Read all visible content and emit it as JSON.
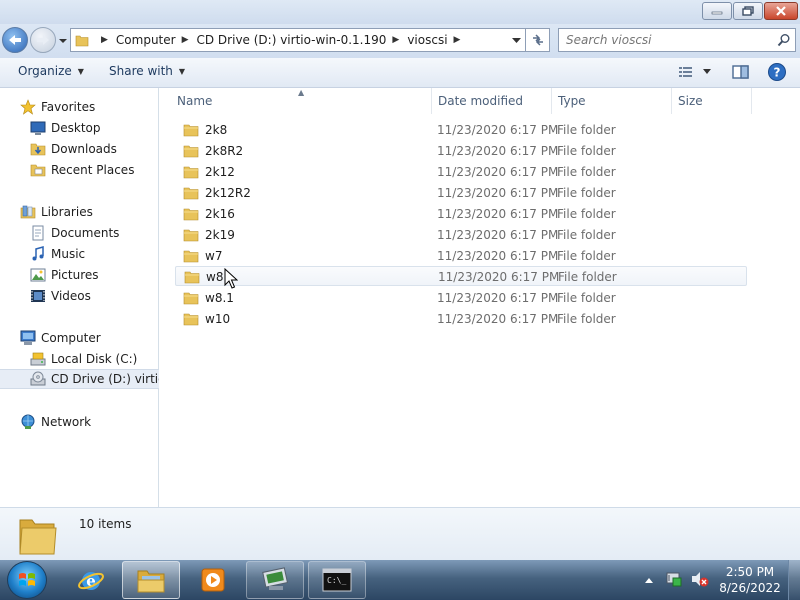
{
  "window": {
    "minimize_icon": "minimize-icon",
    "maximize_icon": "restore-icon",
    "close_icon": "close-icon"
  },
  "address": {
    "crumbs": [
      "Computer",
      "CD Drive (D:) virtio-win-0.1.190",
      "vioscsi"
    ],
    "search_placeholder": "Search vioscsi"
  },
  "toolbar": {
    "organize_label": "Organize",
    "share_label": "Share with"
  },
  "nav": {
    "favorites": "Favorites",
    "desktop": "Desktop",
    "downloads": "Downloads",
    "recent": "Recent Places",
    "libraries": "Libraries",
    "documents": "Documents",
    "music": "Music",
    "pictures": "Pictures",
    "videos": "Videos",
    "computer": "Computer",
    "local_disk": "Local Disk (C:)",
    "cd_drive": "CD Drive (D:) virtio-w",
    "network": "Network"
  },
  "columns": {
    "name": "Name",
    "date": "Date modified",
    "type": "Type",
    "size": "Size"
  },
  "files": [
    {
      "name": "2k8",
      "date": "11/23/2020 6:17 PM",
      "type": "File folder"
    },
    {
      "name": "2k8R2",
      "date": "11/23/2020 6:17 PM",
      "type": "File folder"
    },
    {
      "name": "2k12",
      "date": "11/23/2020 6:17 PM",
      "type": "File folder"
    },
    {
      "name": "2k12R2",
      "date": "11/23/2020 6:17 PM",
      "type": "File folder"
    },
    {
      "name": "2k16",
      "date": "11/23/2020 6:17 PM",
      "type": "File folder"
    },
    {
      "name": "2k19",
      "date": "11/23/2020 6:17 PM",
      "type": "File folder"
    },
    {
      "name": "w7",
      "date": "11/23/2020 6:17 PM",
      "type": "File folder"
    },
    {
      "name": "w8",
      "date": "11/23/2020 6:17 PM",
      "type": "File folder"
    },
    {
      "name": "w8.1",
      "date": "11/23/2020 6:17 PM",
      "type": "File folder"
    },
    {
      "name": "w10",
      "date": "11/23/2020 6:17 PM",
      "type": "File folder"
    }
  ],
  "details": {
    "count": "10 items"
  },
  "taskbar": {
    "time": "2:50 PM",
    "date": "8/26/2022"
  },
  "colors": {
    "folder": "#e8c35a",
    "accent": "#2b63b3",
    "taskbar": "#3b5674"
  }
}
